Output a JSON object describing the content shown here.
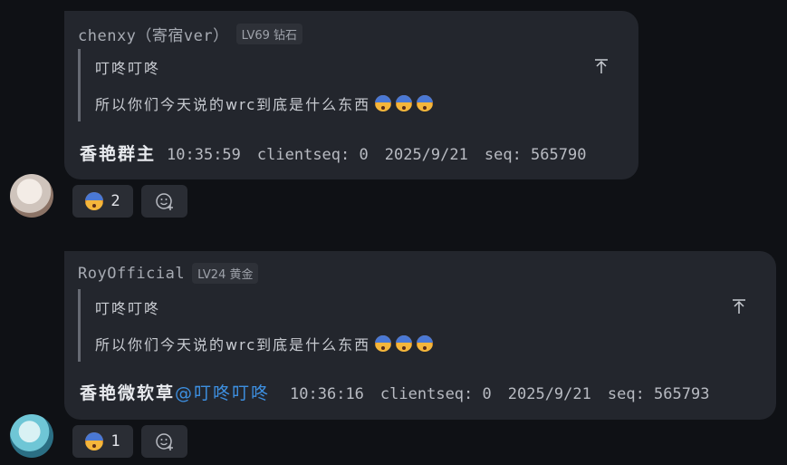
{
  "messages": [
    {
      "sender": "chenxy（寄宿ver）",
      "level": "LV69 钻石",
      "quote_author": "叮咚叮咚",
      "quote_text": "所以你们今天说的wrc到底是什么东西",
      "quote_emojis": [
        "fearful-face-icon",
        "fearful-face-icon",
        "fearful-face-icon"
      ],
      "content": "香艳群主",
      "mention": "",
      "time": "10:35:59",
      "clientseq": "clientseq: 0",
      "date": "2025/9/21",
      "seq": "seq: 565790",
      "reaction_count": "2"
    },
    {
      "sender": "RoyOfficial",
      "level": "LV24 黄金",
      "quote_author": "叮咚叮咚",
      "quote_text": "所以你们今天说的wrc到底是什么东西",
      "quote_emojis": [
        "fearful-face-icon",
        "fearful-face-icon",
        "fearful-face-icon"
      ],
      "content": "香艳微软草",
      "mention": "@叮咚叮咚",
      "time": "10:36:16",
      "clientseq": "clientseq: 0",
      "date": "2025/9/21",
      "seq": "seq: 565793",
      "reaction_count": "1"
    }
  ],
  "colors": {
    "background": "#0f1115",
    "bubble": "#23262d",
    "mention": "#3d8fe0"
  }
}
